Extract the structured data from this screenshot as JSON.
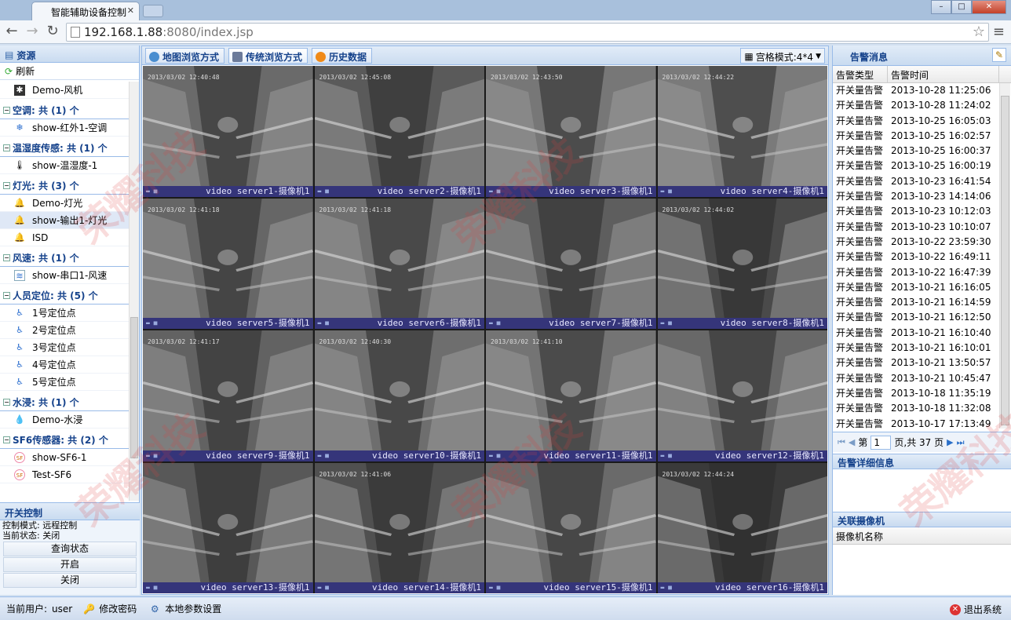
{
  "browser": {
    "tab_title": "智能辅助设备控制",
    "tab_close": "✕",
    "address_host": "192.168.1.88",
    "address_rest": ":8080/index.jsp",
    "back": "←",
    "forward": "→",
    "reload": "↻"
  },
  "left": {
    "header": "资源",
    "refresh": "刷新",
    "top_item": "Demo-风机",
    "groups": [
      {
        "title": "空调: 共 (1) 个",
        "items": [
          {
            "label": "show-红外1-空调",
            "icon": "aircon-icon"
          }
        ]
      },
      {
        "title": "温湿度传感: 共 (1) 个",
        "items": [
          {
            "label": "show-温湿度-1",
            "icon": "thermometer-icon"
          }
        ]
      },
      {
        "title": "灯光: 共 (3) 个",
        "items": [
          {
            "label": "Demo-灯光",
            "icon": "bell-lamp-icon"
          },
          {
            "label": "show-输出1-灯光",
            "icon": "bell-lamp-icon"
          },
          {
            "label": "ISD",
            "icon": "bell-lamp-icon"
          }
        ]
      },
      {
        "title": "风速: 共 (1) 个",
        "items": [
          {
            "label": "show-串口1-风速",
            "icon": "wind-speed-icon"
          }
        ]
      },
      {
        "title": "人员定位: 共 (5) 个",
        "items": [
          {
            "label": "1号定位点",
            "icon": "person-icon"
          },
          {
            "label": "2号定位点",
            "icon": "person-icon"
          },
          {
            "label": "3号定位点",
            "icon": "person-icon"
          },
          {
            "label": "4号定位点",
            "icon": "person-icon"
          },
          {
            "label": "5号定位点",
            "icon": "person-icon"
          }
        ]
      },
      {
        "title": "水浸: 共 (1) 个",
        "items": [
          {
            "label": "Demo-水浸",
            "icon": "water-drop-icon"
          }
        ]
      },
      {
        "title": "SF6传感器: 共 (2) 个",
        "items": [
          {
            "label": "show-SF6-1",
            "icon": "sf6-icon"
          },
          {
            "label": "Test-SF6",
            "icon": "sf6-icon"
          }
        ]
      }
    ],
    "switch_panel": {
      "header": "开关控制",
      "mode": "控制模式: 远程控制",
      "state": "当前状态: 关闭",
      "query": "查询状态",
      "open": "开启",
      "close": "关闭"
    }
  },
  "center": {
    "tabs": [
      "地图浏览方式",
      "传统浏览方式",
      "历史数据"
    ],
    "grid_mode": "宫格模式:4*4",
    "cameras": [
      {
        "label": "video server1-摄像机1",
        "ts": "2013/03/02 12:40:48"
      },
      {
        "label": "video server2-摄像机1",
        "ts": "2013/03/02 12:45:08"
      },
      {
        "label": "video server3-摄像机1",
        "ts": "2013/03/02 12:43:50"
      },
      {
        "label": "video server4-摄像机1",
        "ts": "2013/03/02 12:44:22"
      },
      {
        "label": "video server5-摄像机1",
        "ts": "2013/03/02 12:41:18"
      },
      {
        "label": "video server6-摄像机1",
        "ts": "2013/03/02 12:41:18"
      },
      {
        "label": "video server7-摄像机1",
        "ts": ""
      },
      {
        "label": "video server8-摄像机1",
        "ts": "2013/03/02 12:44:02"
      },
      {
        "label": "video server9-摄像机1",
        "ts": "2013/03/02 12:41:17"
      },
      {
        "label": "video server10-摄像机1",
        "ts": "2013/03/02 12:40:30"
      },
      {
        "label": "video server11-摄像机1",
        "ts": "2013/03/02 12:41:10"
      },
      {
        "label": "video server12-摄像机1",
        "ts": ""
      },
      {
        "label": "video server13-摄像机1",
        "ts": ""
      },
      {
        "label": "video server14-摄像机1",
        "ts": "2013/03/02 12:41:06"
      },
      {
        "label": "video server15-摄像机1",
        "ts": ""
      },
      {
        "label": "video server16-摄像机1",
        "ts": "2013/03/02 12:44:24"
      }
    ]
  },
  "right": {
    "header": "告警消息",
    "col_type": "告警类型",
    "col_time": "告警时间",
    "alarms": [
      {
        "type": "开关量告警",
        "time": "2013-10-28 11:25:06"
      },
      {
        "type": "开关量告警",
        "time": "2013-10-28 11:24:02"
      },
      {
        "type": "开关量告警",
        "time": "2013-10-25 16:05:03"
      },
      {
        "type": "开关量告警",
        "time": "2013-10-25 16:02:57"
      },
      {
        "type": "开关量告警",
        "time": "2013-10-25 16:00:37"
      },
      {
        "type": "开关量告警",
        "time": "2013-10-25 16:00:19"
      },
      {
        "type": "开关量告警",
        "time": "2013-10-23 16:41:54"
      },
      {
        "type": "开关量告警",
        "time": "2013-10-23 14:14:06"
      },
      {
        "type": "开关量告警",
        "time": "2013-10-23 10:12:03"
      },
      {
        "type": "开关量告警",
        "time": "2013-10-23 10:10:07"
      },
      {
        "type": "开关量告警",
        "time": "2013-10-22 23:59:30"
      },
      {
        "type": "开关量告警",
        "time": "2013-10-22 16:49:11"
      },
      {
        "type": "开关量告警",
        "time": "2013-10-22 16:47:39"
      },
      {
        "type": "开关量告警",
        "time": "2013-10-21 16:16:05"
      },
      {
        "type": "开关量告警",
        "time": "2013-10-21 16:14:59"
      },
      {
        "type": "开关量告警",
        "time": "2013-10-21 16:12:50"
      },
      {
        "type": "开关量告警",
        "time": "2013-10-21 16:10:40"
      },
      {
        "type": "开关量告警",
        "time": "2013-10-21 16:10:01"
      },
      {
        "type": "开关量告警",
        "time": "2013-10-21 13:50:57"
      },
      {
        "type": "开关量告警",
        "time": "2013-10-21 10:45:47"
      },
      {
        "type": "开关量告警",
        "time": "2013-10-18 11:35:19"
      },
      {
        "type": "开关量告警",
        "time": "2013-10-18 11:32:08"
      },
      {
        "type": "开关量告警",
        "time": "2013-10-17 17:13:49"
      }
    ],
    "pager": {
      "prefix": "第",
      "page": "1",
      "suffix": "页,共 37 页"
    },
    "detail_header": "告警详细信息",
    "camera_header": "关联摄像机",
    "camera_col": "摄像机名称"
  },
  "statusbar": {
    "user_label": "当前用户: ",
    "user": "user",
    "change_pwd": "修改密码",
    "local_settings": "本地参数设置",
    "logout": "退出系统"
  },
  "watermark": "荣耀科技"
}
